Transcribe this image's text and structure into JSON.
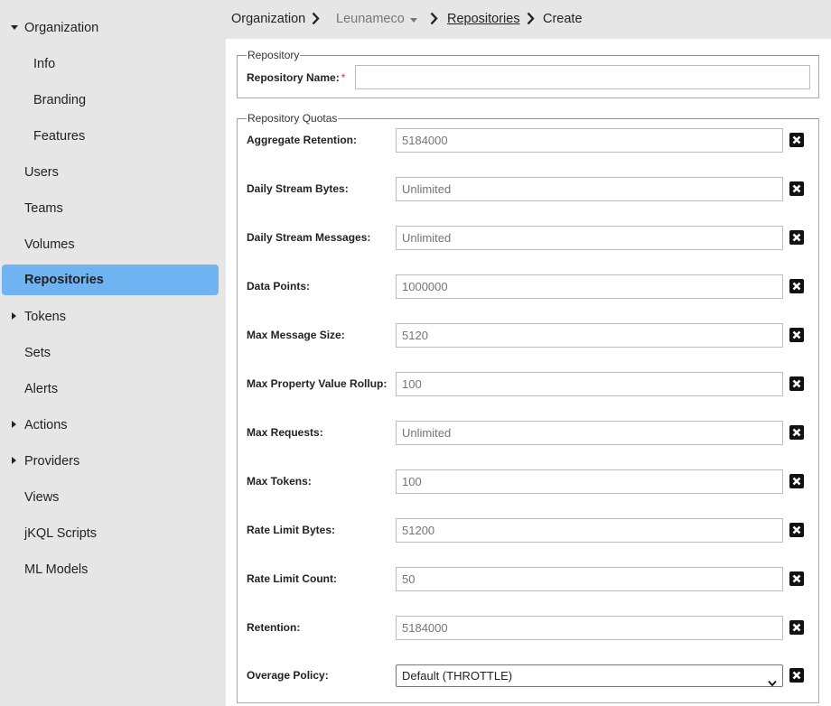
{
  "sidebar": {
    "items": [
      {
        "label": "Organization",
        "caret": "down"
      },
      {
        "label": "Info"
      },
      {
        "label": "Branding"
      },
      {
        "label": "Features"
      },
      {
        "label": "Users"
      },
      {
        "label": "Teams"
      },
      {
        "label": "Volumes"
      },
      {
        "label": "Repositories",
        "active": true
      },
      {
        "label": "Tokens",
        "caret": "right"
      },
      {
        "label": "Sets"
      },
      {
        "label": "Alerts"
      },
      {
        "label": "Actions",
        "caret": "right"
      },
      {
        "label": "Providers",
        "caret": "right"
      },
      {
        "label": "Views"
      },
      {
        "label": "jKQL Scripts"
      },
      {
        "label": "ML Models"
      }
    ]
  },
  "breadcrumb": {
    "organization": "Organization",
    "org_name": "Leunameco",
    "repositories": "Repositories",
    "current": "Create"
  },
  "repository": {
    "legend": "Repository",
    "name_label": "Repository Name:",
    "required_mark": "*",
    "name_value": ""
  },
  "quotas": {
    "legend": "Repository Quotas",
    "fields": [
      {
        "label": "Aggregate Retention:",
        "placeholder": "5184000"
      },
      {
        "label": "Daily Stream Bytes:",
        "placeholder": "Unlimited"
      },
      {
        "label": "Daily Stream Messages:",
        "placeholder": "Unlimited"
      },
      {
        "label": "Data Points:",
        "placeholder": "1000000"
      },
      {
        "label": "Max Message Size:",
        "placeholder": "5120"
      },
      {
        "label": "Max Property Value Rollup:",
        "placeholder": "100"
      },
      {
        "label": "Max Requests:",
        "placeholder": "Unlimited"
      },
      {
        "label": "Max Tokens:",
        "placeholder": "100"
      },
      {
        "label": "Rate Limit Bytes:",
        "placeholder": "51200"
      },
      {
        "label": "Rate Limit Count:",
        "placeholder": "50"
      },
      {
        "label": "Retention:",
        "placeholder": "5184000"
      }
    ],
    "overage": {
      "label": "Overage Policy:",
      "selected": "Default (THROTTLE)"
    }
  },
  "icons": {
    "clear": "close-square-icon",
    "breadcrumb_separator": "chevron-right-icon"
  },
  "colors": {
    "active_nav": "#6fb3f2",
    "required": "#dd3333"
  }
}
